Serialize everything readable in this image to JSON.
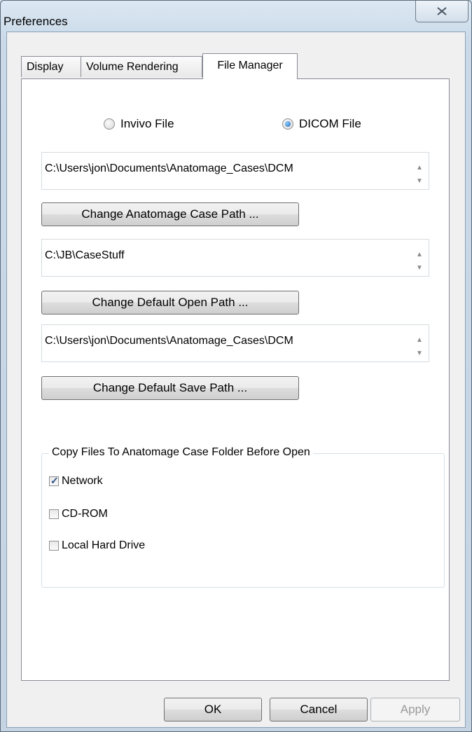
{
  "window": {
    "title": "Preferences"
  },
  "tabs": [
    {
      "label": "Display",
      "active": false
    },
    {
      "label": "Volume Rendering",
      "active": false
    },
    {
      "label": "File Manager",
      "active": true
    }
  ],
  "file_type": {
    "options": [
      {
        "label": "Invivo File",
        "selected": false
      },
      {
        "label": "DICOM File",
        "selected": true
      }
    ]
  },
  "paths": [
    {
      "value": "C:\\Users\\jon\\Documents\\Anatomage_Cases\\DCM",
      "button": "Change Anatomage Case Path ..."
    },
    {
      "value": "C:\\JB\\CaseStuff",
      "button": "Change Default Open Path ..."
    },
    {
      "value": "C:\\Users\\jon\\Documents\\Anatomage_Cases\\DCM",
      "button": "Change Default Save Path ..."
    }
  ],
  "copy_group": {
    "legend": "Copy Files To Anatomage Case Folder Before Open",
    "options": [
      {
        "label": "Network",
        "checked": true
      },
      {
        "label": "CD-ROM",
        "checked": false
      },
      {
        "label": "Local Hard Drive",
        "checked": false
      }
    ]
  },
  "footer": {
    "ok": "OK",
    "cancel": "Cancel",
    "apply": "Apply",
    "apply_enabled": false
  },
  "icons": {
    "close": "close-x-icon",
    "scroll_up": "scroll-up-arrow-icon",
    "scroll_down": "scroll-down-arrow-icon"
  }
}
